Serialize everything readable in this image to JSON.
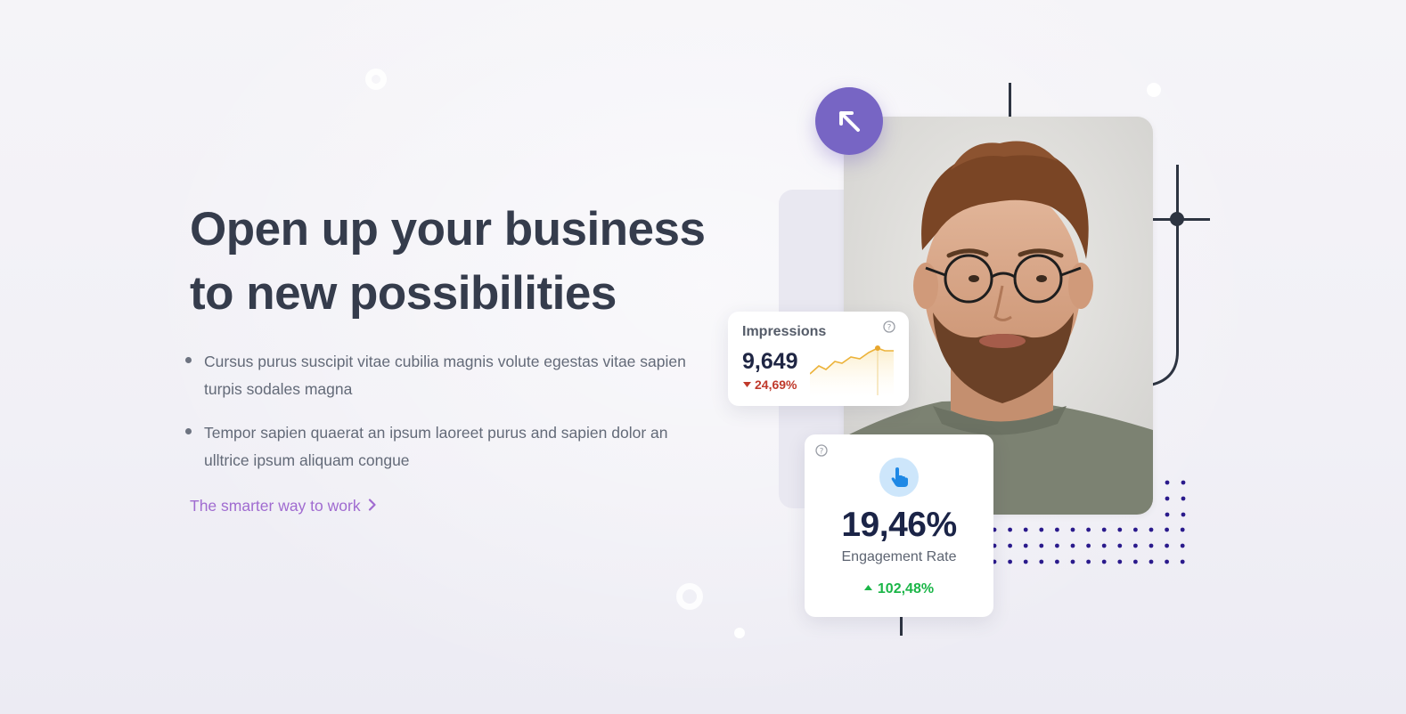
{
  "hero": {
    "title_line1": "Open up your business",
    "title_line2": "to new possibilities"
  },
  "bullets": [
    {
      "text": "Cursus purus suscipit vitae cubilia magnis volute egestas vitae sapien turpis sodales magna"
    },
    {
      "text": "Tempor sapien quaerat an ipsum laoreet purus and sapien dolor an ulltrice ipsum aliquam congue"
    }
  ],
  "cta": {
    "label": "The smarter way to work",
    "icon": "chevron-right-icon"
  },
  "impressions_card": {
    "title": "Impressions",
    "value": "9,649",
    "change": "24,69%",
    "change_direction": "down",
    "change_color": "#c0392b",
    "help_icon": "question-circle-icon"
  },
  "engagement_card": {
    "value": "19,46%",
    "label": "Engagement Rate",
    "change": "102,48%",
    "change_direction": "up",
    "change_color": "#1bb648",
    "icon": "pointer-hand-icon",
    "help_icon": "question-circle-icon"
  },
  "floating_button": {
    "icon": "arrow-up-left-icon",
    "color": "#7765c4"
  },
  "colors": {
    "accent_purple": "#7765c4",
    "link_purple": "#a06bd0",
    "heading": "#353c4c",
    "dot_grid": "#2a1a8c"
  }
}
